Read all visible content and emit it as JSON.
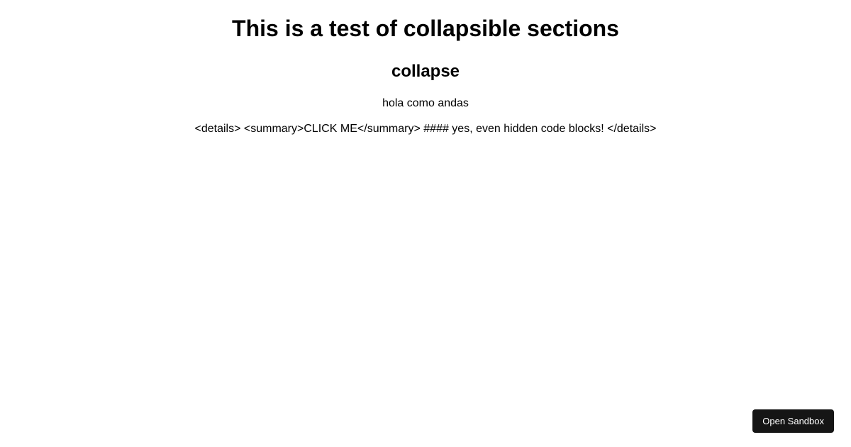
{
  "header": {
    "title": "This is a test of collapsible sections",
    "subtitle": "collapse"
  },
  "body": {
    "greeting": "hola como andas",
    "raw_markup": "<details> <summary>CLICK ME</summary> #### yes, even hidden code blocks! </details>"
  },
  "footer": {
    "sandbox_button_label": "Open Sandbox"
  }
}
